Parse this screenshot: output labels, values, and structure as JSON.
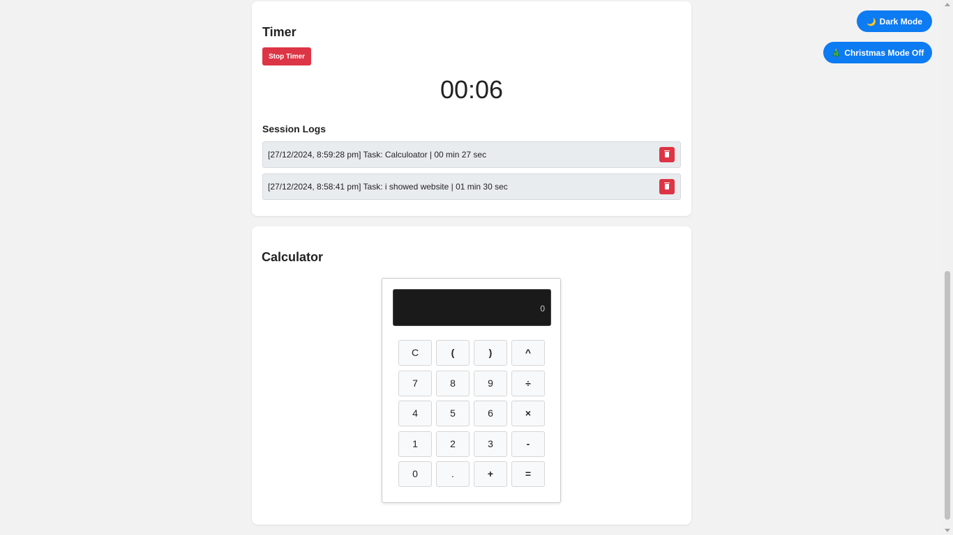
{
  "timer": {
    "title": "Timer",
    "stop_label": "Stop Timer",
    "display": "00:06",
    "logs_title": "Session Logs",
    "logs": [
      {
        "text": "[27/12/2024, 8:59:28 pm] Task: Calculoator | 00 min 27 sec"
      },
      {
        "text": "[27/12/2024, 8:58:41 pm] Task: i showed website | 01 min 30 sec"
      }
    ]
  },
  "calculator": {
    "title": "Calculator",
    "display": "0",
    "buttons": [
      [
        "C",
        "(",
        ")",
        "^"
      ],
      [
        "7",
        "8",
        "9",
        "÷"
      ],
      [
        "4",
        "5",
        "6",
        "×"
      ],
      [
        "1",
        "2",
        "3",
        "-"
      ],
      [
        "0",
        ".",
        "+",
        "="
      ]
    ]
  },
  "modes": {
    "dark_label": "Dark Mode",
    "dark_icon": "🌙",
    "christmas_label": "Christmas Mode Off",
    "christmas_icon": "🎄"
  },
  "colors": {
    "danger": "#dc3545",
    "primary": "#0d7bf2",
    "display_bg": "#1a1a1a"
  }
}
